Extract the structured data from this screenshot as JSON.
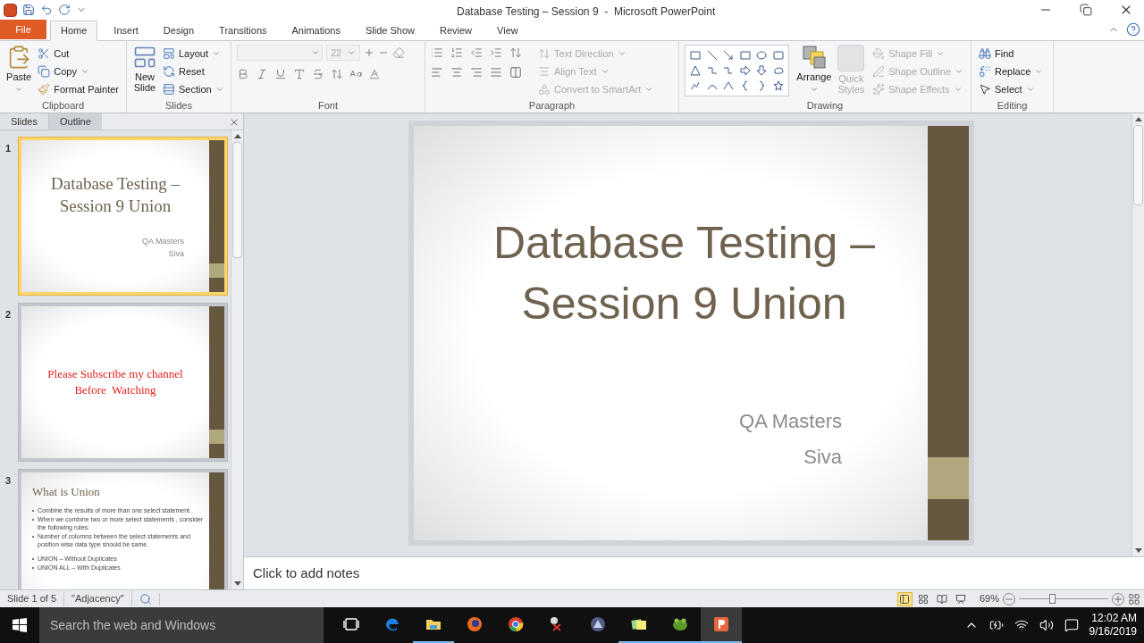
{
  "window": {
    "title": "Database Testing – Session 9  -  Microsoft PowerPoint"
  },
  "tabs": [
    {
      "label": "File",
      "kind": "file",
      "selected": false
    },
    {
      "label": "Home",
      "kind": "tab",
      "selected": true
    },
    {
      "label": "Insert",
      "kind": "tab",
      "selected": false
    },
    {
      "label": "Design",
      "kind": "tab",
      "selected": false
    },
    {
      "label": "Transitions",
      "kind": "tab",
      "selected": false
    },
    {
      "label": "Animations",
      "kind": "tab",
      "selected": false
    },
    {
      "label": "Slide Show",
      "kind": "tab",
      "selected": false
    },
    {
      "label": "Review",
      "kind": "tab",
      "selected": false
    },
    {
      "label": "View",
      "kind": "tab",
      "selected": false
    }
  ],
  "ribbon": {
    "clipboard": {
      "label": "Clipboard",
      "paste": "Paste",
      "items": [
        "Cut",
        "Copy",
        "Format Painter"
      ]
    },
    "slides": {
      "label": "Slides",
      "new_slide": "New Slide",
      "items": [
        "Layout",
        "Reset",
        "Section"
      ]
    },
    "font": {
      "label": "Font",
      "font_size": "22"
    },
    "paragraph": {
      "label": "Paragraph",
      "items": [
        {
          "label": "Text Direction",
          "disabled": true
        },
        {
          "label": "Align Text",
          "disabled": true
        },
        {
          "label": "Convert to SmartArt",
          "disabled": true
        }
      ]
    },
    "drawing": {
      "label": "Drawing",
      "arrange": "Arrange",
      "quick_styles": {
        "label": "Quick Styles",
        "disabled": true
      },
      "items": [
        {
          "label": "Shape Fill",
          "disabled": true
        },
        {
          "label": "Shape Outline",
          "disabled": true
        },
        {
          "label": "Shape Effects",
          "disabled": true
        }
      ]
    },
    "editing": {
      "label": "Editing",
      "items": [
        "Find",
        "Replace",
        "Select"
      ]
    }
  },
  "panel": {
    "tabs": [
      {
        "label": "Slides",
        "selected": true
      },
      {
        "label": "Outline",
        "selected": false
      }
    ],
    "thumbnails": [
      {
        "number": "1",
        "kind": "title",
        "selected": true,
        "title": "Database Testing – Session 9 Union",
        "subtitle": [
          "QA Masters",
          "Siva"
        ]
      },
      {
        "number": "2",
        "kind": "message",
        "selected": false,
        "lines": [
          "Please Subscribe my channel",
          "Before  Watching"
        ]
      },
      {
        "number": "3",
        "kind": "content",
        "selected": false,
        "title": "What is Union",
        "bullet_groups": [
          [
            "Combine the results of more than one select statement.",
            "When  we combine two or more select statements  , consider the following rules:",
            "Number of columns between  the select statements  and position wise data type should be same."
          ],
          [
            "UNION – Without Duplicates",
            "UNION ALL – With Duplicates"
          ]
        ]
      }
    ]
  },
  "slide": {
    "title": "Database Testing – Session 9 Union",
    "subtitle": [
      "QA Masters",
      "Siva"
    ]
  },
  "notes": {
    "placeholder": "Click to add notes"
  },
  "status_bar": {
    "items": [
      "Slide 1 of 5",
      "\"Adjacency\""
    ],
    "views": [
      {
        "selected": true
      },
      {
        "selected": false
      },
      {
        "selected": false
      },
      {
        "selected": false
      }
    ],
    "zoom": "69%",
    "zoom_slider": {
      "level": 0.37
    }
  },
  "taskbar": {
    "search": {
      "placeholder": "Search the web and Windows"
    },
    "apps": [
      {
        "kind": "taskview",
        "running": false
      },
      {
        "kind": "edge",
        "running": false
      },
      {
        "kind": "folder",
        "running": true
      },
      {
        "kind": "firefox",
        "running": false
      },
      {
        "kind": "chrome",
        "running": false
      },
      {
        "kind": "snip",
        "running": false
      },
      {
        "kind": "globe",
        "running": false
      },
      {
        "kind": "notes",
        "running": true
      },
      {
        "kind": "frog",
        "running": true
      },
      {
        "kind": "powerpoint",
        "running": true,
        "selected": true
      }
    ],
    "time": "12:02 AM",
    "date": "9/16/2019"
  }
}
